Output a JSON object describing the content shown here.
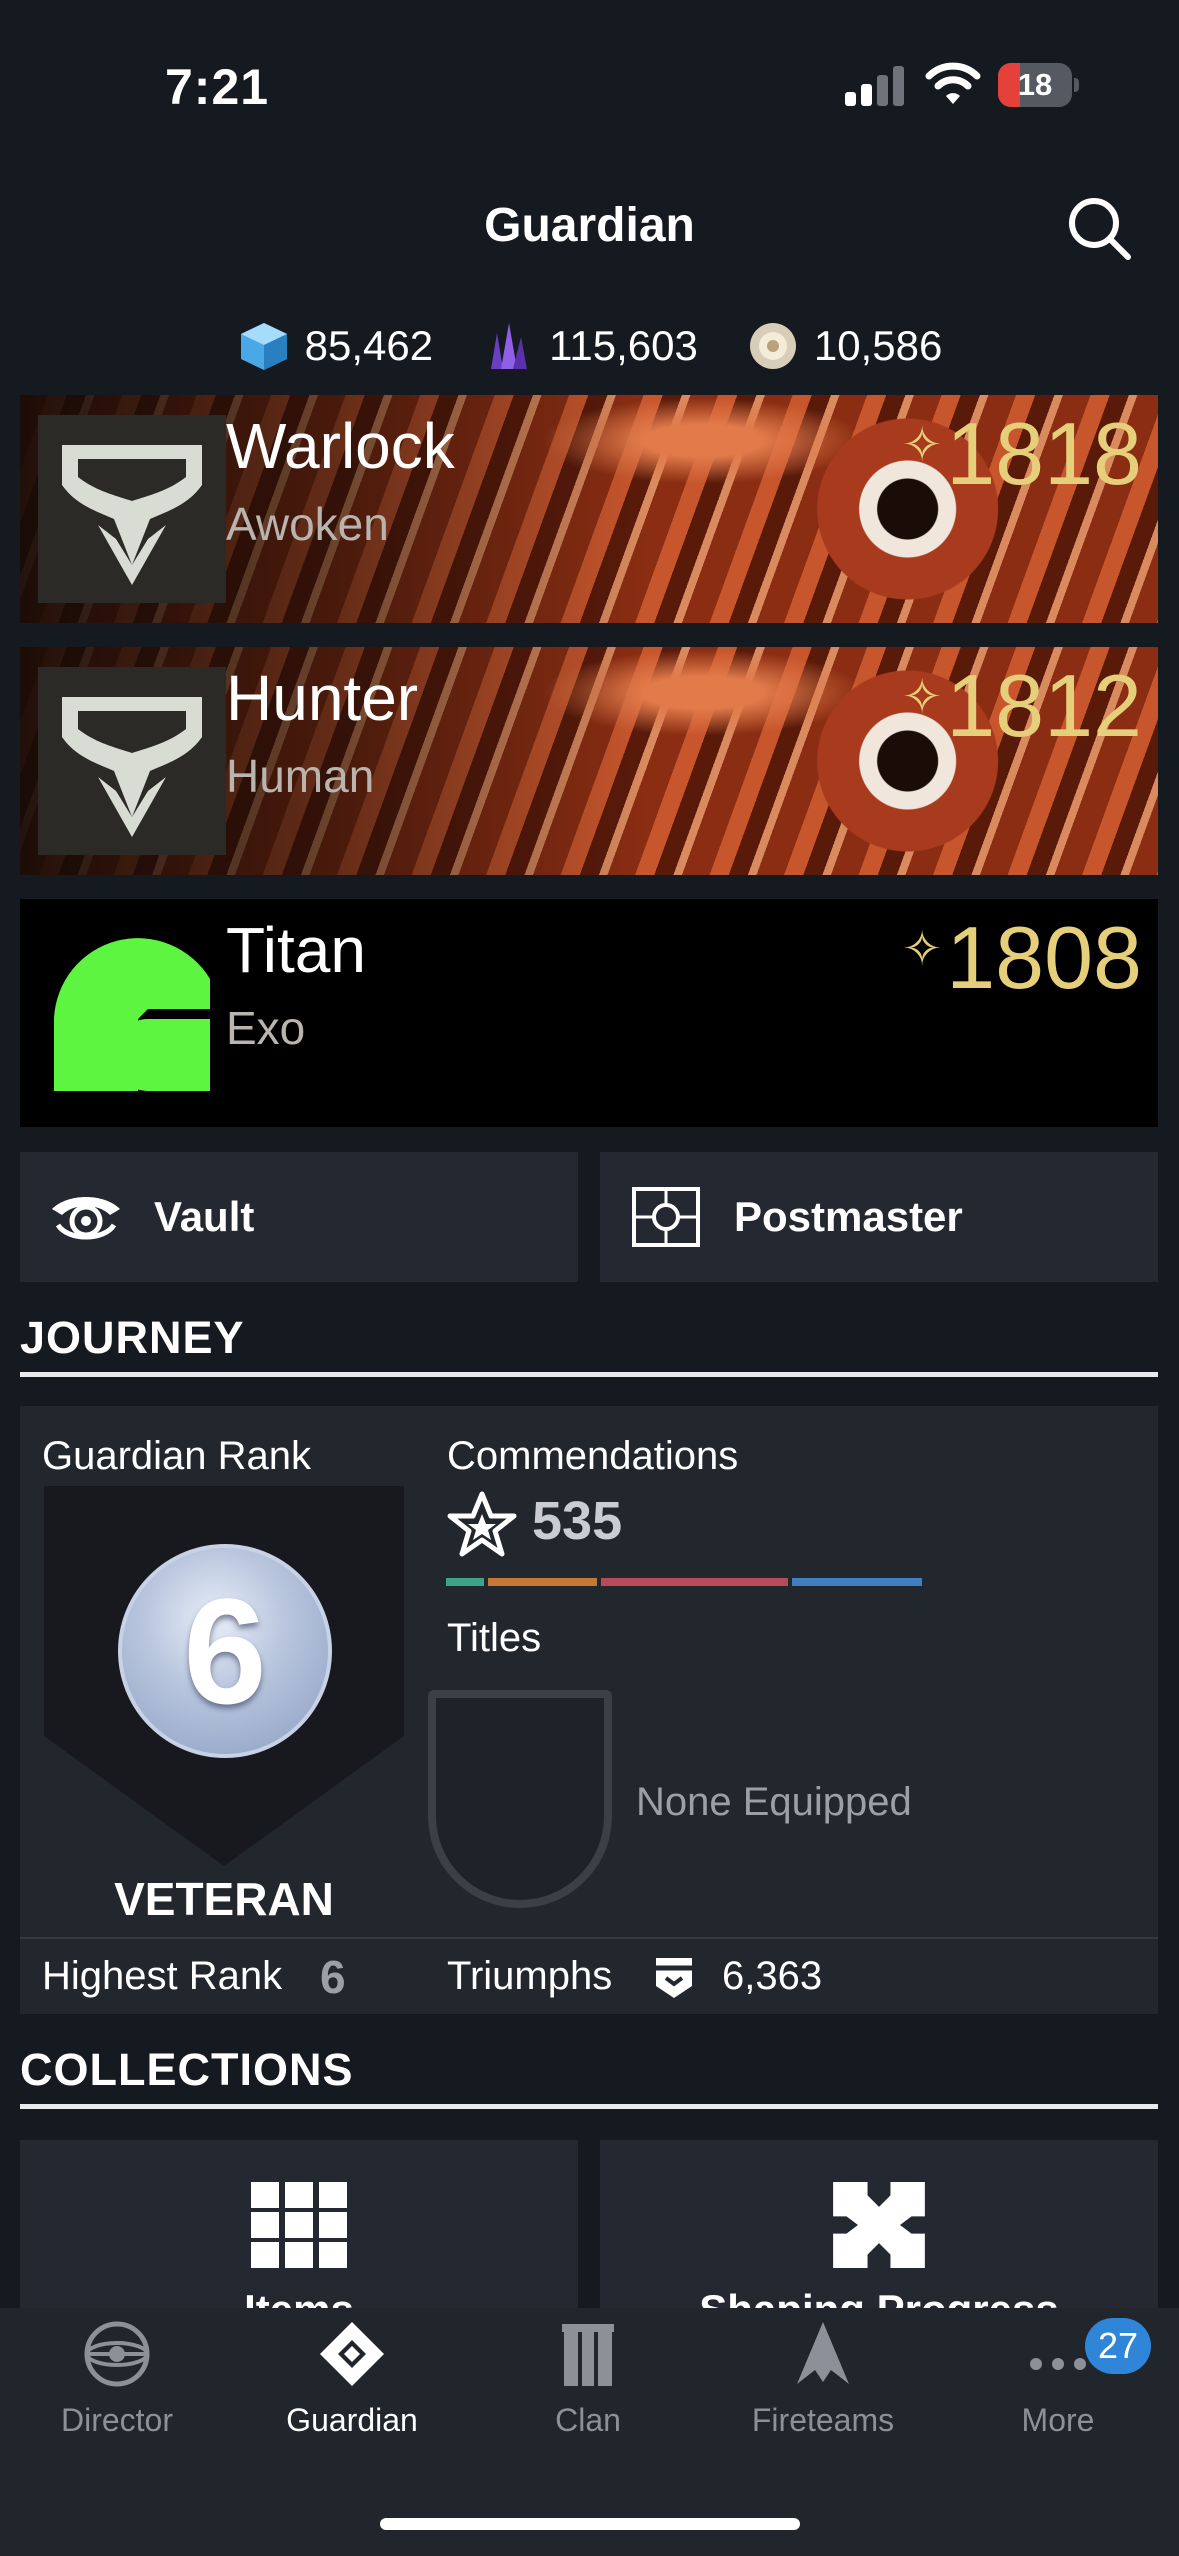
{
  "status_bar": {
    "time": "7:21",
    "battery": "18"
  },
  "header": {
    "title": "Guardian",
    "search_icon": "search-icon"
  },
  "currencies": [
    {
      "icon": "glimmer-icon",
      "value": "85,462"
    },
    {
      "icon": "legendary-shards-icon",
      "value": "115,603"
    },
    {
      "icon": "bright-dust-icon",
      "value": "10,586"
    }
  ],
  "characters": [
    {
      "class": "Warlock",
      "race": "Awoken",
      "power": "1818",
      "star": "✧"
    },
    {
      "class": "Hunter",
      "race": "Human",
      "power": "1812",
      "star": "✧"
    },
    {
      "class": "Titan",
      "race": "Exo",
      "power": "1808",
      "star": "✧"
    }
  ],
  "actions": {
    "vault": "Vault",
    "postmaster": "Postmaster"
  },
  "journey": {
    "heading": "JOURNEY",
    "guardian_rank_label": "Guardian Rank",
    "rank": "6",
    "rank_name": "VETERAN",
    "commendations_label": "Commendations",
    "commendations": "535",
    "commendation_segments": [
      {
        "color": "#3fa28a",
        "fraction": 0.06
      },
      {
        "color": "#c47a35",
        "fraction": 0.16
      },
      {
        "color": "#b94a5a",
        "fraction": 0.27
      },
      {
        "color": "#3f7fc0",
        "fraction": 0.19
      }
    ],
    "titles_label": "Titles",
    "title_value": "None Equipped",
    "highest_rank_label": "Highest Rank",
    "highest_rank": "6",
    "triumphs_label": "Triumphs",
    "triumphs": "6,363"
  },
  "collections": {
    "heading": "COLLECTIONS",
    "tiles": [
      "Items",
      "Shaping Progress"
    ]
  },
  "tabs": [
    {
      "label": "Director",
      "icon": "director-icon"
    },
    {
      "label": "Guardian",
      "icon": "guardian-icon",
      "active": true
    },
    {
      "label": "Clan",
      "icon": "clan-icon"
    },
    {
      "label": "Fireteams",
      "icon": "fireteams-icon"
    },
    {
      "label": "More",
      "icon": "more-icon",
      "badge": "27"
    }
  ],
  "colors": {
    "background": "#151920",
    "power_gold": "#e6cf7a",
    "badge_blue": "#2f86d8",
    "titan_emblem": "#5ef540"
  }
}
